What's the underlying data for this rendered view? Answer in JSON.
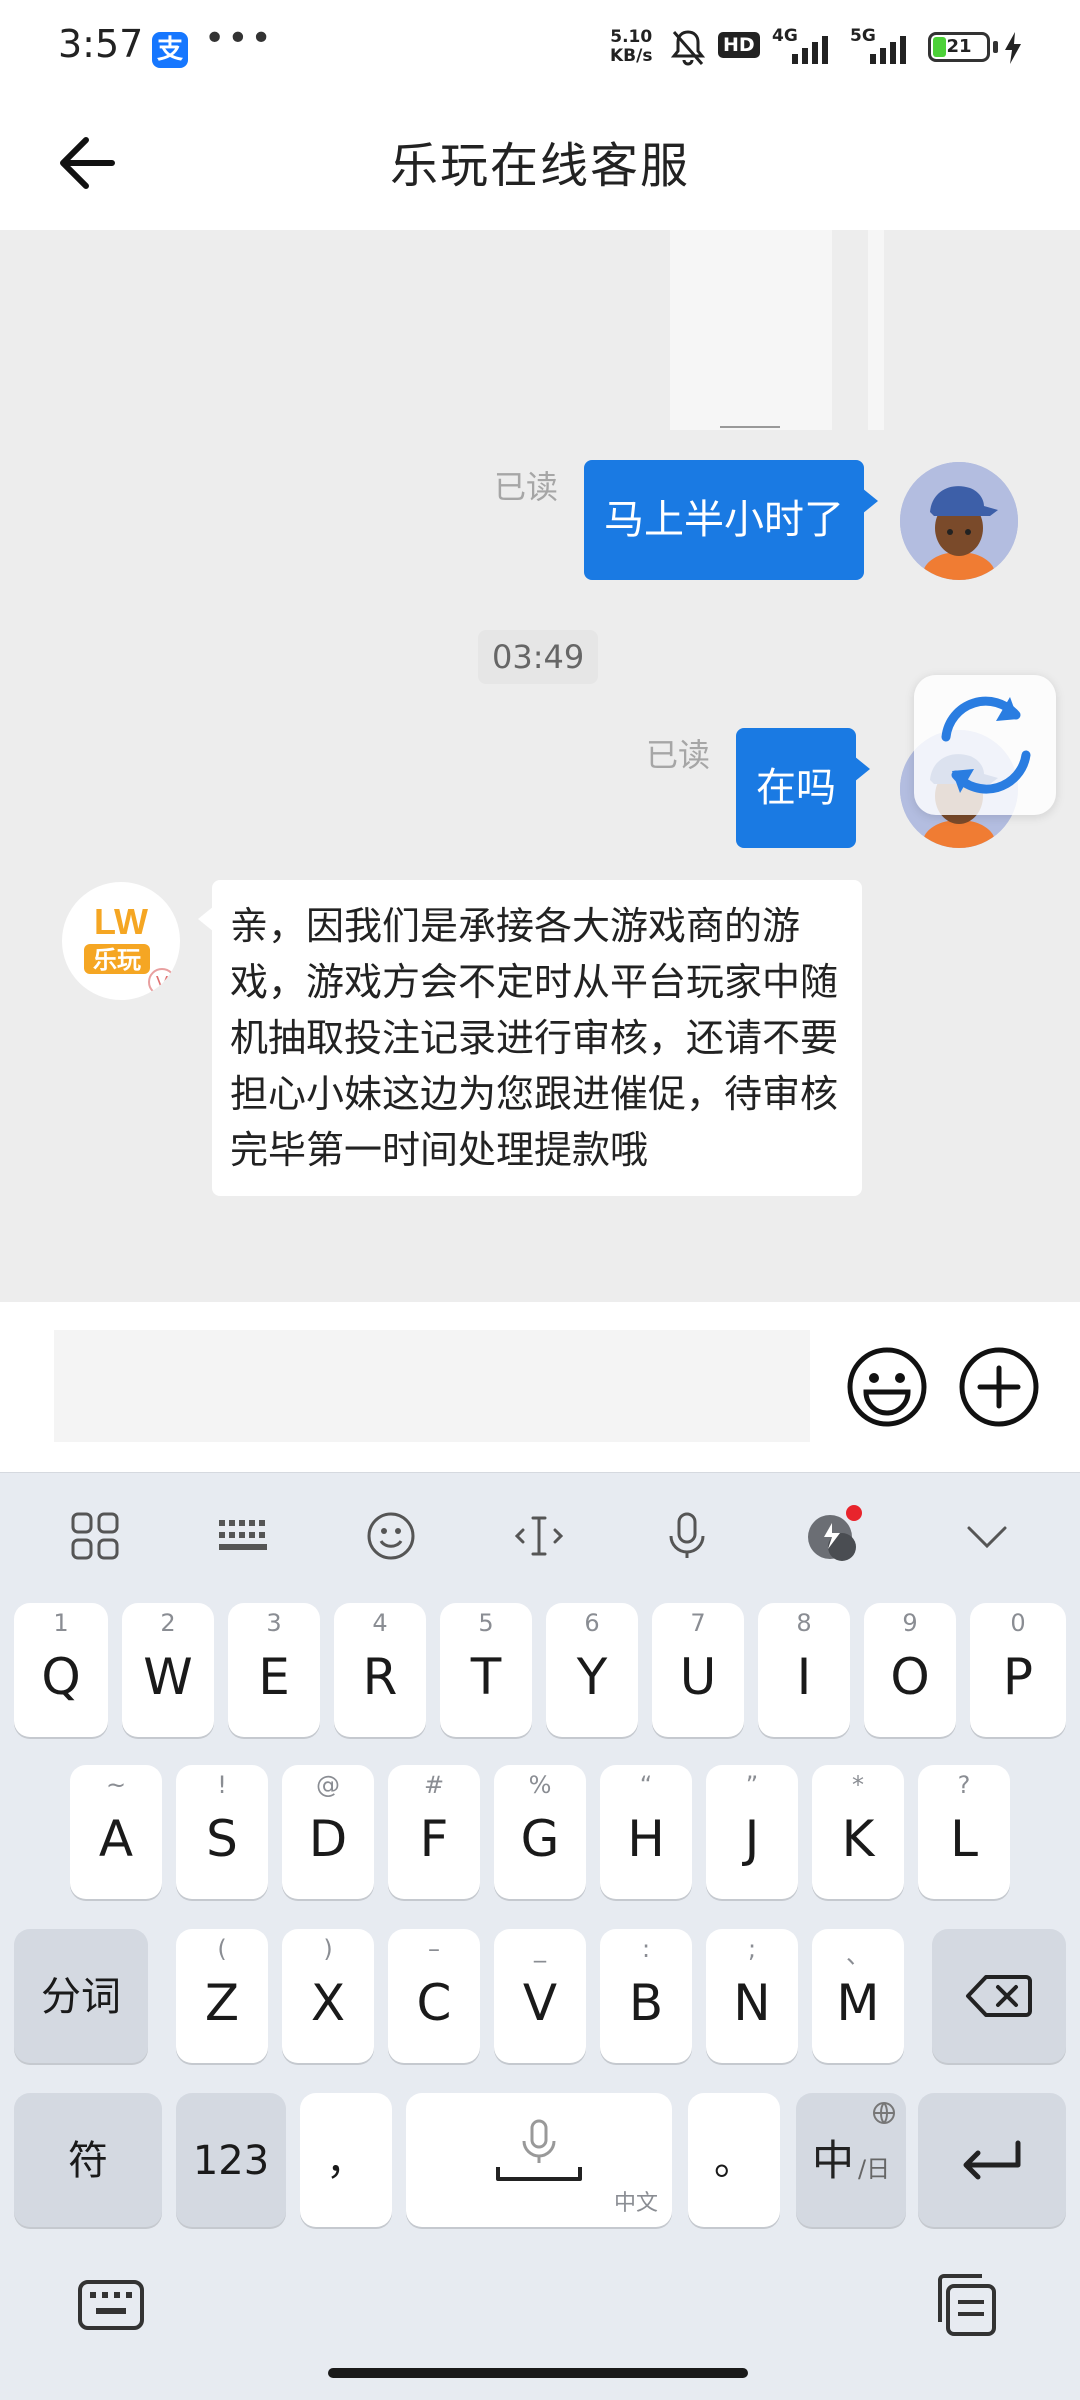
{
  "status_bar": {
    "time": "3:57",
    "alipay_glyph": "支",
    "more": "•••",
    "speed_value": "5.10",
    "speed_unit": "KB/s",
    "hd": "HD",
    "net_4g": "4G",
    "net_5g": "5G",
    "battery": "21",
    "battery_level": 0.21
  },
  "header": {
    "title": "乐玩在线客服"
  },
  "chat": {
    "messages": [
      {
        "from": "user",
        "read_label": "已读",
        "text": "马上半小时了"
      },
      {
        "type": "timestamp",
        "text": "03:49"
      },
      {
        "from": "user",
        "read_label": "已读",
        "text": "在吗"
      },
      {
        "from": "agent",
        "avatar_logo": "LW",
        "avatar_brand": "乐玩",
        "avatar_badge": "V",
        "text": "亲，因我们是承接各大游戏商的游戏，游戏方会不定时从平台玩家中随机抽取投注记录进行审核，还请不要担心小妹这边为您跟进催促，待审核完毕第一时间处理提款哦"
      }
    ]
  },
  "input_bar": {
    "placeholder": ""
  },
  "keyboard": {
    "row1": [
      {
        "hint": "1",
        "key": "Q"
      },
      {
        "hint": "2",
        "key": "W"
      },
      {
        "hint": "3",
        "key": "E"
      },
      {
        "hint": "4",
        "key": "R"
      },
      {
        "hint": "5",
        "key": "T"
      },
      {
        "hint": "6",
        "key": "Y"
      },
      {
        "hint": "7",
        "key": "U"
      },
      {
        "hint": "8",
        "key": "I"
      },
      {
        "hint": "9",
        "key": "O"
      },
      {
        "hint": "0",
        "key": "P"
      }
    ],
    "row2": [
      {
        "hint": "~",
        "key": "A"
      },
      {
        "hint": "!",
        "key": "S"
      },
      {
        "hint": "@",
        "key": "D"
      },
      {
        "hint": "#",
        "key": "F"
      },
      {
        "hint": "%",
        "key": "G"
      },
      {
        "hint": "“",
        "key": "H"
      },
      {
        "hint": "”",
        "key": "J"
      },
      {
        "hint": "*",
        "key": "K"
      },
      {
        "hint": "?",
        "key": "L"
      }
    ],
    "row3": [
      {
        "hint": "(",
        "key": "Z"
      },
      {
        "hint": ")",
        "key": "X"
      },
      {
        "hint": "–",
        "key": "C"
      },
      {
        "hint": "_",
        "key": "V"
      },
      {
        "hint": ":",
        "key": "B"
      },
      {
        "hint": ";",
        "key": "N"
      },
      {
        "hint": "、",
        "key": "M"
      }
    ],
    "fenci": "分词",
    "fu": "符",
    "num": "123",
    "comma": "，",
    "space_sub": "中文",
    "period": "。",
    "lang_main": "中",
    "lang_sub": "/日"
  },
  "colors": {
    "bubble_out": "#1a7ae3",
    "keyboard_bg": "#e7ebf1",
    "fn_key": "#d4d9e1"
  }
}
